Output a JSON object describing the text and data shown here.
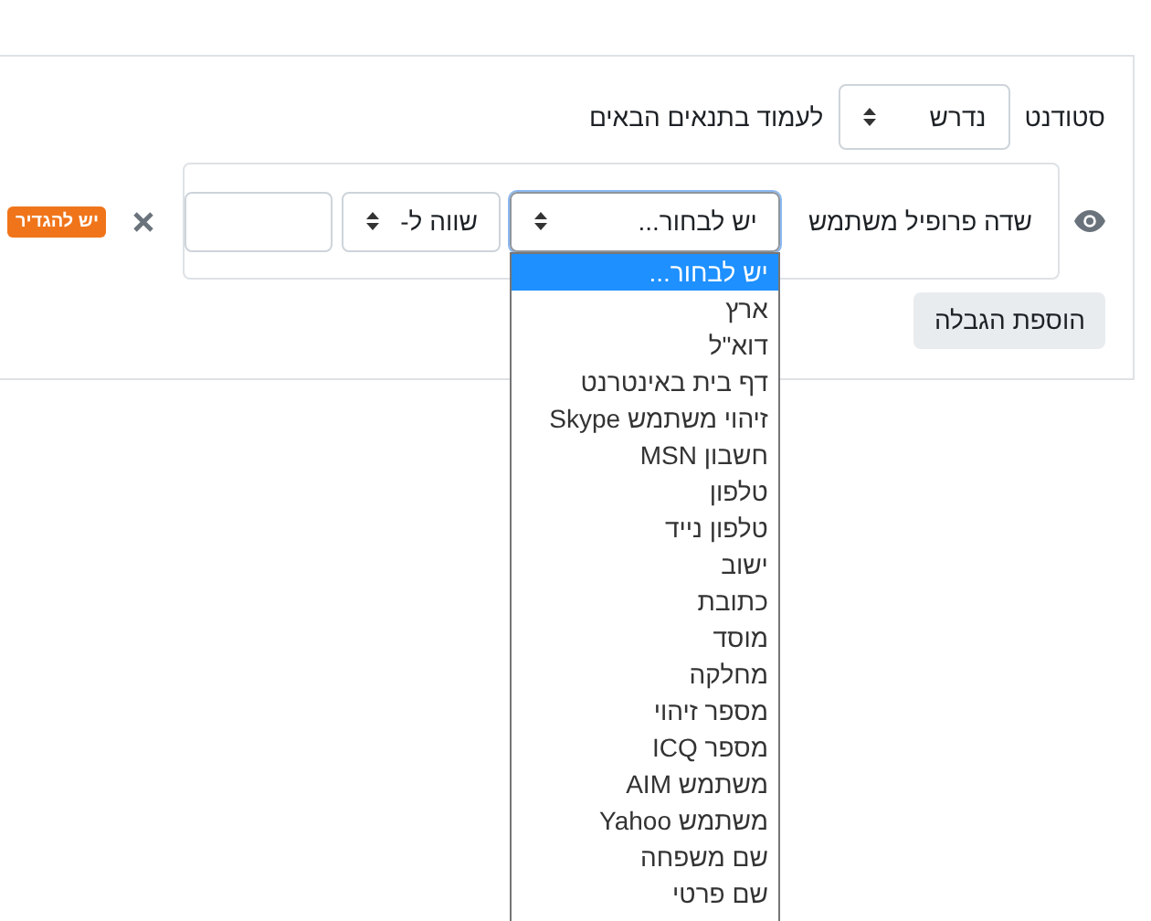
{
  "header_row": {
    "label": "סטודנט",
    "select_value": "נדרש",
    "suffix": "לעמוד בתנאים הבאים"
  },
  "condition": {
    "field_label": "שדה פרופיל משתמש",
    "field_select": "יש לבחור...",
    "operator_select": "שווה ל-",
    "badge": "יש להגדיר"
  },
  "dropdown_options": [
    {
      "label": "יש לבחור...",
      "selected": true
    },
    {
      "label": "ארץ",
      "selected": false
    },
    {
      "label": "דוא\"ל",
      "selected": false
    },
    {
      "label": "דף בית באינטרנט",
      "selected": false
    },
    {
      "label": "זיהוי משתמש Skype",
      "selected": false
    },
    {
      "label": "חשבון MSN",
      "selected": false
    },
    {
      "label": "טלפון",
      "selected": false
    },
    {
      "label": "טלפון נייד",
      "selected": false
    },
    {
      "label": "ישוב",
      "selected": false
    },
    {
      "label": "כתובת",
      "selected": false
    },
    {
      "label": "מוסד",
      "selected": false
    },
    {
      "label": "מחלקה",
      "selected": false
    },
    {
      "label": "מספר זיהוי",
      "selected": false
    },
    {
      "label": "מספר ICQ",
      "selected": false
    },
    {
      "label": "משתמש AIM",
      "selected": false
    },
    {
      "label": "משתמש Yahoo",
      "selected": false
    },
    {
      "label": "שם משפחה",
      "selected": false
    },
    {
      "label": "שם פרטי",
      "selected": false
    }
  ],
  "add_button": "הוספת הגבלה"
}
